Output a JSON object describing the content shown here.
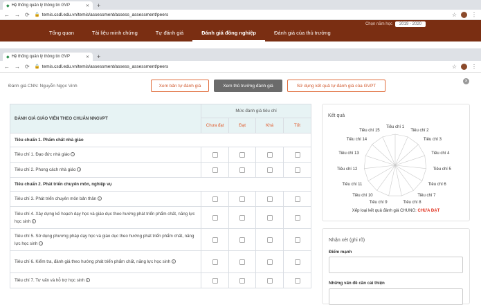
{
  "back_browser": {
    "tab_title": "Hệ thống quản lý thông tin GVP",
    "url": "temis.csdl.edu.vn/temis/assessment/assess_assessment/peers"
  },
  "back_navbar": {
    "items": [
      "Tổng quan",
      "Tài liệu minh chứng",
      "Tự đánh giá",
      "Đánh giá đồng nghiệp",
      "Đánh giá của thủ trưởng"
    ],
    "year_label": "Chọn năm học",
    "year_value": "2019 - 2020"
  },
  "browser": {
    "tab_title": "Hệ thống quản lý thông tin GVP",
    "url": "temis.csdl.edu.vn/temis/assessment/assess_assessment/peers"
  },
  "page": {
    "evaluator": "Đánh giá CNN: Nguyễn Ngọc Vinh",
    "buttons": {
      "self_assessment": "Xem bản tự đánh giá",
      "principal": "Xem thủ trưởng đánh giá",
      "use_result": "Sử dụng kết quả tự đánh giá của GVPT"
    }
  },
  "table": {
    "main_header": "ĐÁNH GIÁ GIÁO VIÊN THEO CHUẨN NNGVPT",
    "level_header": "Mức đánh giá tiêu chí",
    "levels": [
      "Chưa đạt",
      "Đạt",
      "Khá",
      "Tốt"
    ],
    "standard1": "Tiêu chuẩn 1. Phẩm chất nhà giáo",
    "c1": "Tiêu chí 1. Đạo đức nhà giáo",
    "c2": "Tiêu chí 2. Phong cách nhà giáo",
    "standard2": "Tiêu chuẩn 2. Phát triển chuyên môn, nghiệp vụ",
    "c3": "Tiêu chí 3. Phát triển chuyên môn bản thân",
    "c4": "Tiêu chí 4. Xây dựng kế hoạch dạy học và giáo dục theo hướng phát triển phẩm chất, năng lực học sinh",
    "c5": "Tiêu chí 5. Sử dụng phương pháp dạy học và giáo dục theo hướng phát triển phẩm chất, năng lực học sinh",
    "c6": "Tiêu chí 6. Kiểm tra, đánh giá theo hướng phát triển phẩm chất, năng lực học sinh",
    "c7": "Tiêu chí 7. Tư vấn và hỗ trợ học sinh"
  },
  "result": {
    "title": "Kết quả",
    "labels": [
      "Tiêu chí 1",
      "Tiêu chí 2",
      "Tiêu chí 3",
      "Tiêu chí 4",
      "Tiêu chí 5",
      "Tiêu chí 6",
      "Tiêu chí 7",
      "Tiêu chí 8",
      "Tiêu chí 9",
      "Tiêu chí 10",
      "Tiêu chí 11",
      "Tiêu chí 12",
      "Tiêu chí 13",
      "Tiêu chí 14",
      "Tiêu chí 15"
    ],
    "summary_prefix": "Xếp loại kết quả đánh giá CHUNG:",
    "summary_value": "CHƯA ĐẠT",
    "summary_color": "#e0301e"
  },
  "comments": {
    "title": "Nhận xét (ghi rõ)",
    "strengths": "Điểm mạnh",
    "improve": "Những vấn đề cần cải thiện"
  }
}
